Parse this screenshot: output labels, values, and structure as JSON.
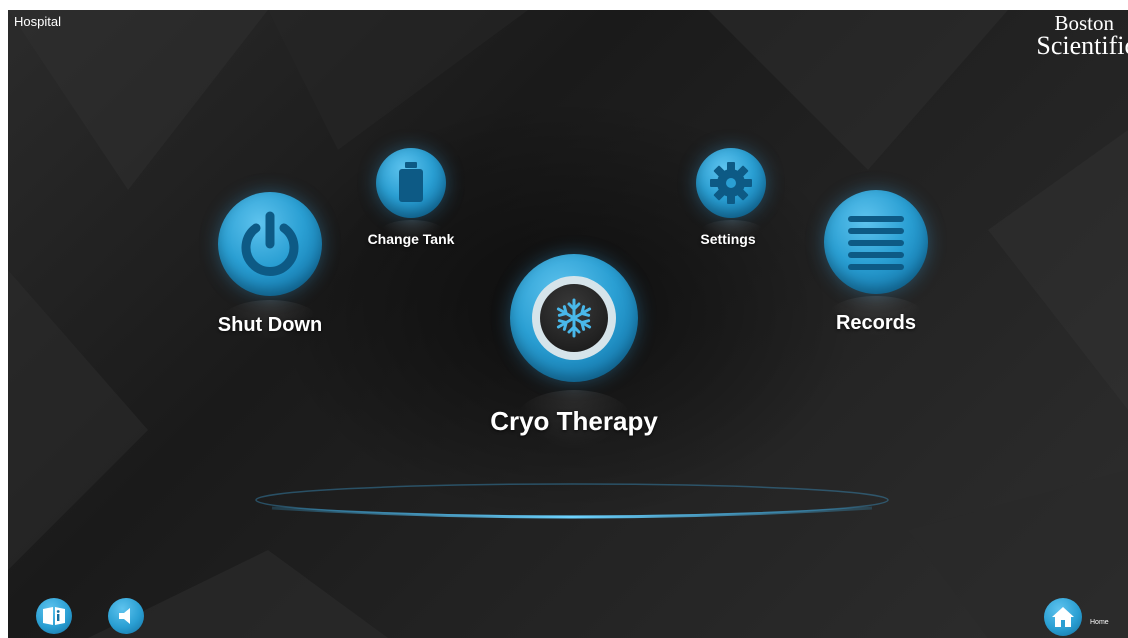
{
  "header": {
    "location": "Hospital"
  },
  "logo": {
    "line1": "Boston",
    "line2": "Scientific"
  },
  "menu": {
    "shut_down": "Shut Down",
    "change_tank": "Change Tank",
    "cryo_therapy": "Cryo Therapy",
    "settings": "Settings",
    "records": "Records"
  },
  "footer": {
    "home": "Home"
  },
  "colors": {
    "accent": "#2a9fd3",
    "background": "#1f1f1f",
    "ring": "#3ab4ef"
  },
  "icons": [
    "power-icon",
    "tank-icon",
    "snowflake-icon",
    "gear-icon",
    "list-icon",
    "manual-icon",
    "speaker-icon",
    "home-icon"
  ]
}
